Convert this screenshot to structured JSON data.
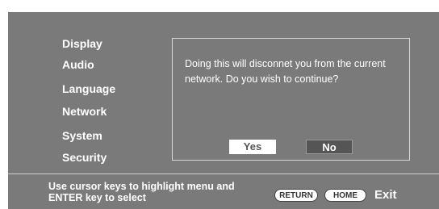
{
  "menu": {
    "items": [
      {
        "label": "Display"
      },
      {
        "label": "Audio"
      },
      {
        "label": "Language"
      },
      {
        "label": "Network"
      },
      {
        "label": "System"
      },
      {
        "label": "Security"
      }
    ]
  },
  "dialog": {
    "message": "Doing this will disconnet you from the current network. Do you wish to continue?",
    "yes_label": "Yes",
    "no_label": "No",
    "selected": "Yes"
  },
  "footer": {
    "hint": "Use cursor keys to highlight menu and ENTER key to select",
    "return_key": "RETURN",
    "home_key": "HOME",
    "exit_label": "Exit"
  },
  "colors": {
    "background": "#7a7a7a",
    "text": "#ffffff",
    "selected_button": "#ffffff",
    "unselected_button": "#555555"
  }
}
